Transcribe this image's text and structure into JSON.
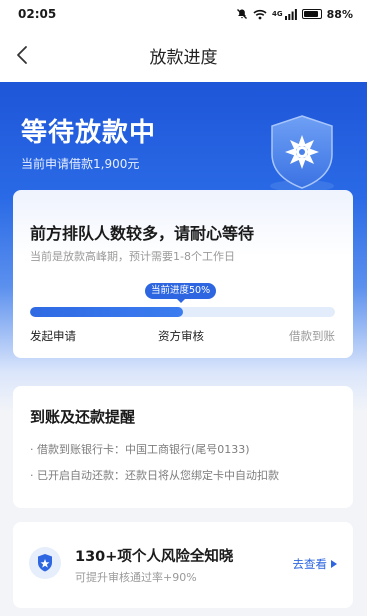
{
  "status_bar": {
    "time": "02:05",
    "network": "4G",
    "battery": "88%",
    "battery_level": 0.88
  },
  "nav": {
    "title": "放款进度",
    "back_icon": "chevron-left-icon"
  },
  "hero": {
    "title": "等待放款中",
    "subtitle": "当前申请借款1,900元",
    "badge_icon": "shield-emblem-icon"
  },
  "progress_card": {
    "title": "前方排队人数较多，请耐心等待",
    "description": "当前是放款高峰期，预计需要1-8个工作日",
    "progress_tip": "当前进度50%",
    "progress": 0.5,
    "steps": [
      "发起申请",
      "资方审核",
      "借款到账"
    ]
  },
  "reminder_card": {
    "title": "到账及还款提醒",
    "items": [
      "· 借款到账银行卡：中国工商银行(尾号0133)",
      "· 已开启自动还款：还款日将从您绑定卡中自动扣款"
    ]
  },
  "risk_card": {
    "title": "130+项个人风险全知晓",
    "subtitle": "可提升审核通过率+90%",
    "link_label": "去查看",
    "icon": "shield-check-icon"
  },
  "colors": {
    "brand": "#2d66e0",
    "hero_top": "#1e56d8",
    "muted_text": "#9a9a9a"
  }
}
